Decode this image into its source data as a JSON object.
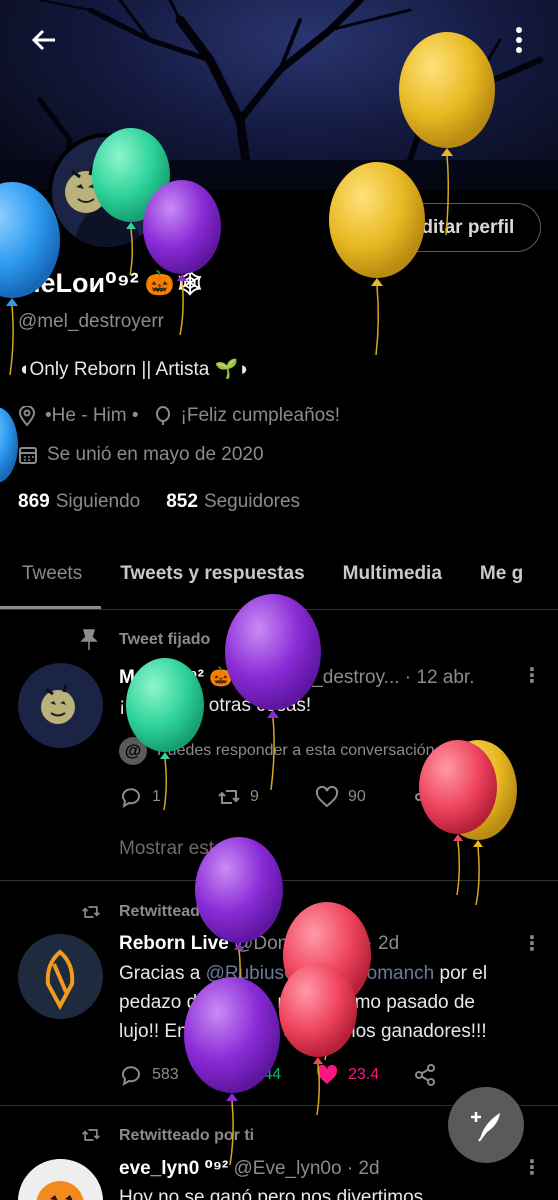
{
  "profile": {
    "name": "MeLoи⁰⁹²",
    "name_emojis": "🎃🕸",
    "handle": "@mel_destroyerr",
    "bio": "◖Only Reborn || Artista 🌱◗",
    "pronouns": "•He - Him •",
    "birthday": "¡Feliz cumpleaños!",
    "joined": "Se unió en mayo de 2020",
    "following_count": "869",
    "following_label": "Siguiendo",
    "followers_count": "852",
    "followers_label": "Seguidores",
    "edit_button": "Editar perfil"
  },
  "tabs": [
    "Tweets",
    "Tweets y respuestas",
    "Multimedia",
    "Me g"
  ],
  "tweets": [
    {
      "context": "Tweet fijado",
      "name": "MeLoи⁰⁹² 🎃🕸",
      "handle": "@mel_destroy...",
      "time": "· 12 abr.",
      "text": "¡Dibujos y otras cosas!",
      "conversation": "Puedes responder a esta conversación",
      "replies": "1",
      "retweets": "9",
      "likes": "90",
      "show_thread": "Mostrar este hilo"
    },
    {
      "context": "Retwitteado por ti",
      "name": "Reborn Live",
      "handle": "@DonReborn2",
      "time": "· 2d",
      "text_a": "Gracias a ",
      "mention": "@RubiusOMG @Komanch",
      "text_b": " por el pedazo de torneo, nos lo hemo pasado de lujo!! Enhorabuena a todos los ganadores!!!",
      "replies": "583",
      "retweets": "1,44",
      "likes": "23.4"
    },
    {
      "context": "Retwitteado por ti",
      "name": "eve_lyn0 ⁰⁹²",
      "handle": "@Eve_lyn0o",
      "time": "· 2d",
      "text": "Hoy no se ganó pero nos divertimos"
    }
  ],
  "colors": {
    "balloon_gold": "#e8b923",
    "balloon_green": "#2fd49a",
    "balloon_purple": "#8a2bd6",
    "balloon_blue": "#2e9bf0",
    "balloon_red": "#f0455f",
    "like_active": "#f91880",
    "retweet_active": "#00ba7c"
  },
  "icons": {
    "back": "arrow-left-icon",
    "menu": "more-vertical-icon",
    "location": "location-pin-icon",
    "birthday": "balloon-icon",
    "calendar": "calendar-icon",
    "compose": "feather-plus-icon"
  }
}
